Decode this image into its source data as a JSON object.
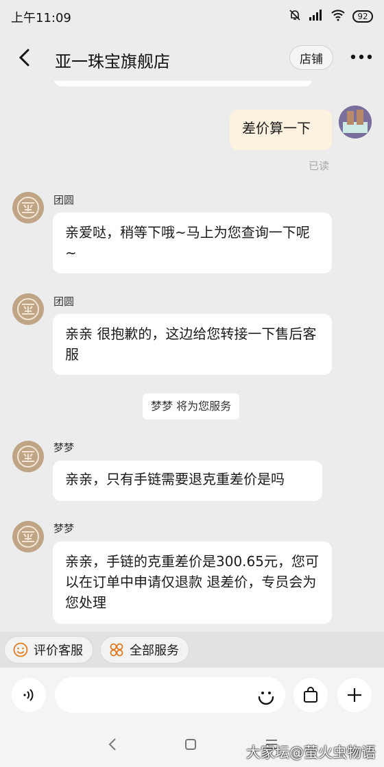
{
  "status": {
    "time": "上午11:09",
    "battery": "92"
  },
  "header": {
    "title": "亚一珠宝旗舰店",
    "store_label": "店铺"
  },
  "messages": [
    {
      "text": "差价算一下",
      "read": "已读"
    },
    {
      "sender": "团圆",
      "text": "亲爱哒，稍等下哦~马上为您查询一下呢~"
    },
    {
      "sender": "团圆",
      "text": "亲亲 很抱歉的，这边给您转接一下售后客服"
    },
    {
      "system": "梦梦 将为您服务"
    },
    {
      "sender": "梦梦",
      "text": "亲亲，只有手链需要退克重差价是吗"
    },
    {
      "sender": "梦梦",
      "text": "亲亲，手链的克重差价是300.65元，您可以在订单中申请仅退款  退差价，专员会为您处理"
    }
  ],
  "quick_actions": [
    {
      "label": "评价客服",
      "icon": "smiley-icon"
    },
    {
      "label": "全部服务",
      "icon": "grid-flower-icon"
    }
  ],
  "input": {
    "placeholder": ""
  },
  "watermark": "大家坛@萤火虫物语",
  "colors": {
    "self_bubble": "#fdf1df",
    "avatar_gold": "#bfa486",
    "background": "#ececec"
  }
}
